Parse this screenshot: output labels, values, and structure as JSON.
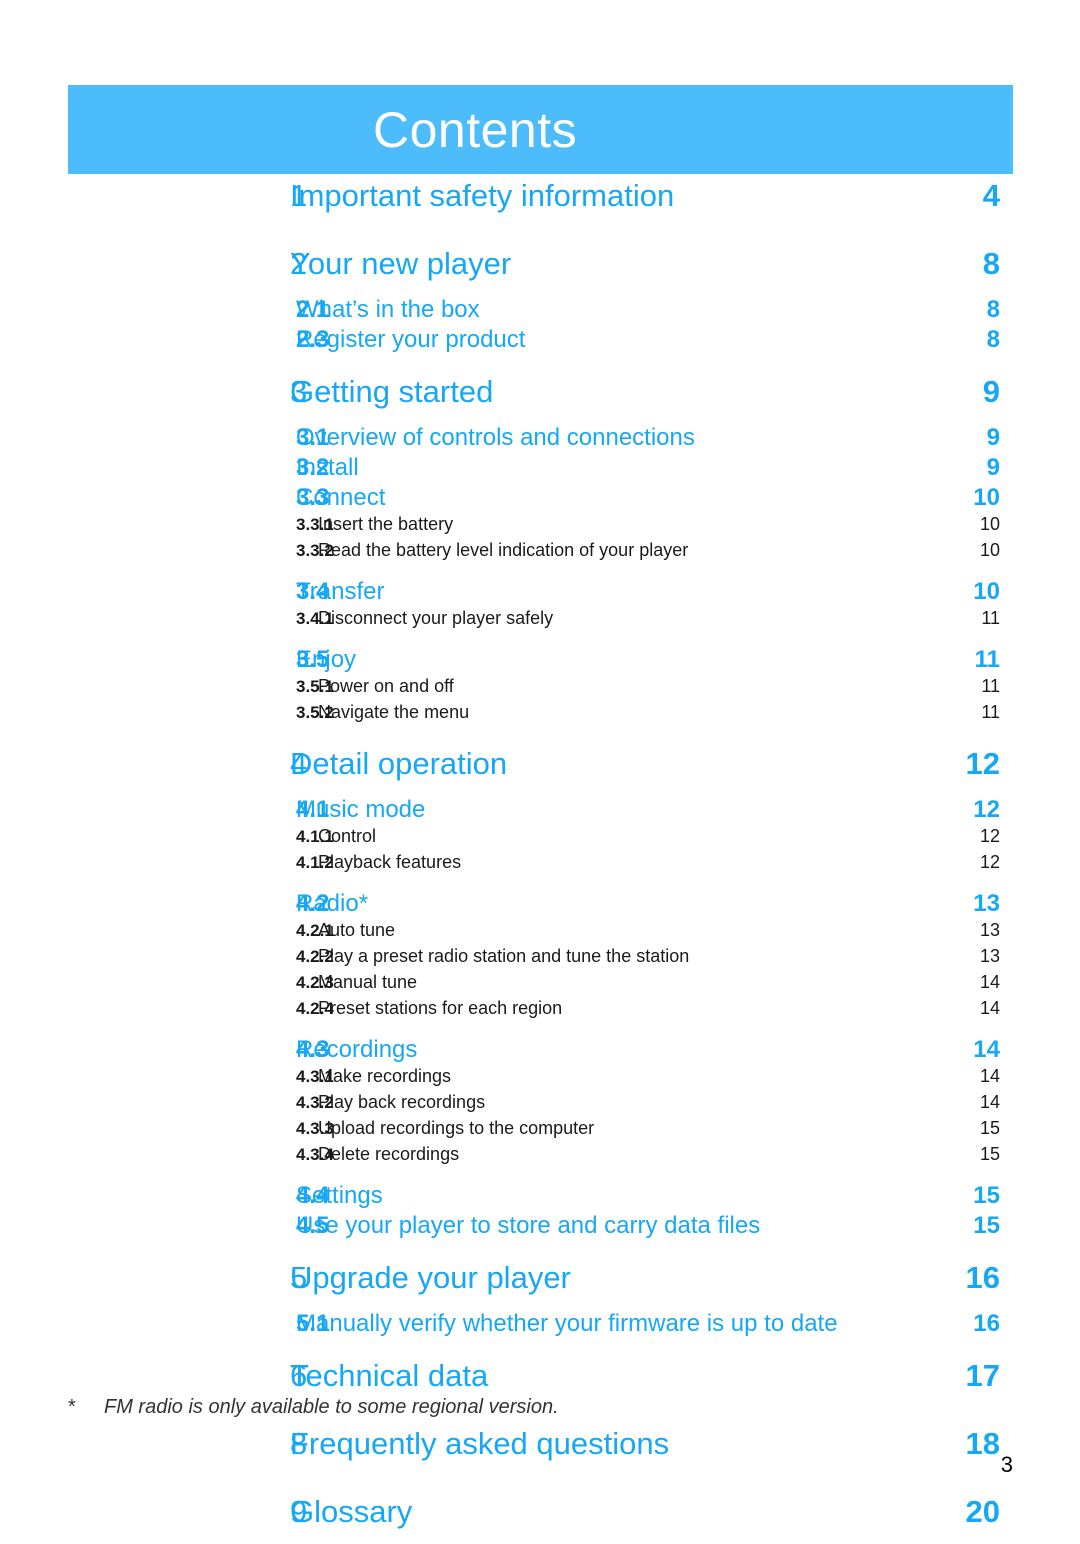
{
  "header": {
    "title": "Contents",
    "banner_color": "#4cbcfb",
    "title_color": "#ffffff"
  },
  "colors": {
    "accent_blue": "#16a7f5",
    "banner_blue": "#4cbcfb",
    "body_black": "#1a1a1a"
  },
  "toc": {
    "entries": [
      {
        "num": "1",
        "label": "Important safety information",
        "page": "4",
        "level": 1
      },
      {
        "num": "2",
        "label": "Your new player",
        "page": "8",
        "level": 1
      },
      {
        "num": "2.1",
        "label": "What’s in the box",
        "page": "8",
        "level": 2
      },
      {
        "num": "2.3",
        "label": "Register your product",
        "page": "8",
        "level": 2
      },
      {
        "num": "3",
        "label": "Getting started",
        "page": "9",
        "level": 1
      },
      {
        "num": "3.1",
        "label": "Overview of controls and connections",
        "page": "9",
        "level": 2
      },
      {
        "num": "3.2",
        "label": "Install",
        "page": "9",
        "level": 2
      },
      {
        "num": "3.3",
        "label": "Connect",
        "page": "10",
        "level": 2
      },
      {
        "num": "3.3.1",
        "label": "Insert the battery",
        "page": "10",
        "level": 3
      },
      {
        "num": "3.3.2",
        "label": "Read the battery level indication of your player",
        "page": "10",
        "level": 3
      },
      {
        "num": "3.4",
        "label": "Transfer",
        "page": "10",
        "level": 2
      },
      {
        "num": "3.4.1",
        "label": "Disconnect your player safely",
        "page": "11",
        "level": 3
      },
      {
        "num": "3.5",
        "label": "Enjoy",
        "page": "11",
        "level": 2
      },
      {
        "num": "3.5.1",
        "label": "Power on and off",
        "page": "11",
        "level": 3
      },
      {
        "num": "3.5.2",
        "label": "Navigate the menu",
        "page": "11",
        "level": 3
      },
      {
        "num": "4",
        "label": "Detail operation",
        "page": "12",
        "level": 1
      },
      {
        "num": "4.1",
        "label": "Music mode",
        "page": "12",
        "level": 2
      },
      {
        "num": "4.1.1",
        "label": "Control",
        "page": "12",
        "level": 3
      },
      {
        "num": "4.1.2",
        "label": "Playback features",
        "page": "12",
        "level": 3
      },
      {
        "num": "4.2",
        "label": "Radio*",
        "page": "13",
        "level": 2
      },
      {
        "num": "4.2.1",
        "label": "Auto tune",
        "page": "13",
        "level": 3
      },
      {
        "num": "4.2.2",
        "label": "Play a preset radio station and tune the station",
        "page": "13",
        "level": 3
      },
      {
        "num": "4.2.3",
        "label": "Manual tune",
        "page": "14",
        "level": 3
      },
      {
        "num": "4.2.4",
        "label": "Preset stations for each region",
        "page": "14",
        "level": 3
      },
      {
        "num": "4.3",
        "label": "Recordings",
        "page": "14",
        "level": 2
      },
      {
        "num": "4.3.1",
        "label": "Make recordings",
        "page": "14",
        "level": 3
      },
      {
        "num": "4.3.2",
        "label": "Play back recordings",
        "page": "14",
        "level": 3
      },
      {
        "num": "4.3.3",
        "label": "Upload recordings to the computer",
        "page": "15",
        "level": 3
      },
      {
        "num": "4.3.4",
        "label": "Delete recordings",
        "page": "15",
        "level": 3
      },
      {
        "num": "4.4",
        "label": "Settings",
        "page": "15",
        "level": 2
      },
      {
        "num": "4.5",
        "label": "Use your player to store and carry data files",
        "page": "15",
        "level": 2
      },
      {
        "num": "5",
        "label": "Upgrade your player",
        "page": "16",
        "level": 1
      },
      {
        "num": "5.1",
        "label": "Manually verify whether your firmware is up to date",
        "page": "16",
        "level": 2
      },
      {
        "num": "6",
        "label": "Technical data",
        "page": "17",
        "level": 1
      },
      {
        "num": "8",
        "label": "Frequently asked questions",
        "page": "18",
        "level": 1
      },
      {
        "num": "9",
        "label": "Glossary",
        "page": "20",
        "level": 1
      }
    ]
  },
  "footnote": {
    "marker": "*",
    "text": "FM radio is only available to some regional version."
  },
  "page_number": "3"
}
